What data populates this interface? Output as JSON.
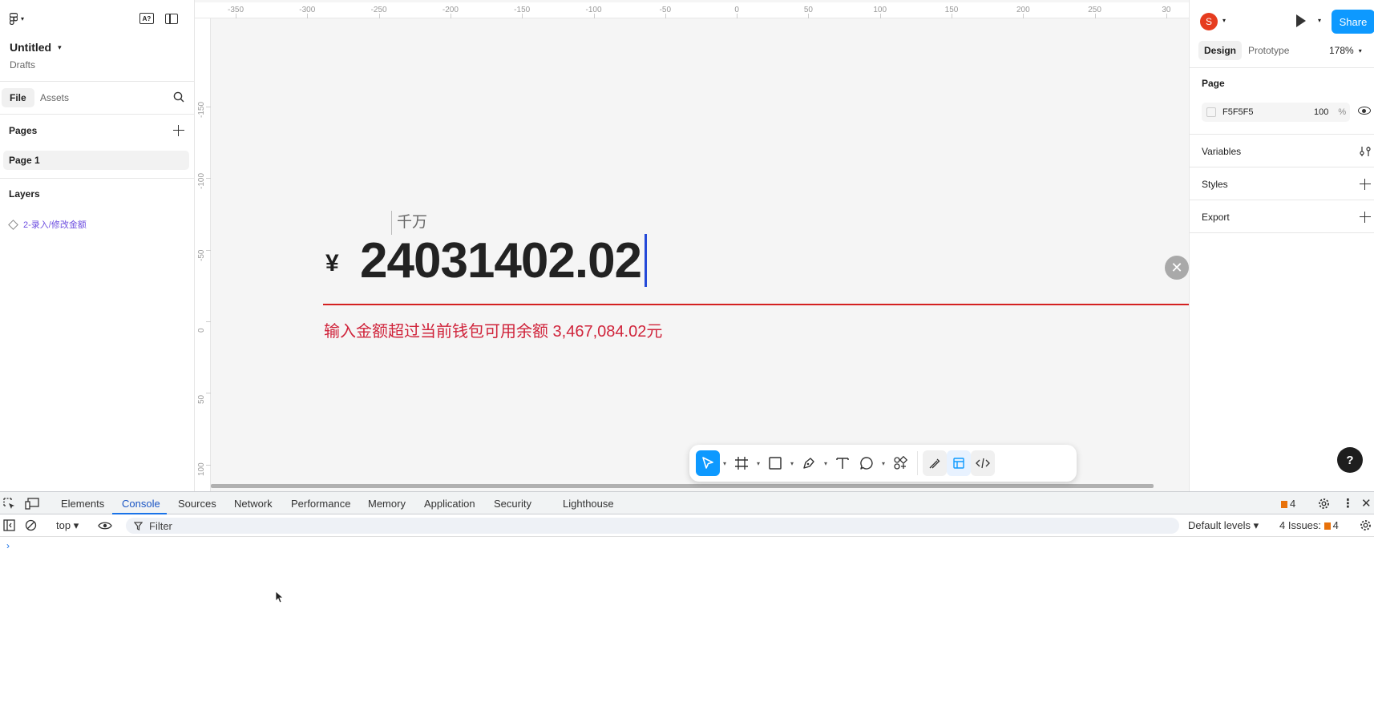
{
  "left_panel": {
    "file_title": "Untitled",
    "file_location": "Drafts",
    "tabs": {
      "file": "File",
      "assets": "Assets"
    },
    "pages_title": "Pages",
    "pages": [
      {
        "label": "Page 1"
      }
    ],
    "layers_title": "Layers",
    "layers": [
      {
        "label": "2-录入/修改金额"
      }
    ]
  },
  "rulers": {
    "top": [
      "-350",
      "-300",
      "-250",
      "-200",
      "-150",
      "-100",
      "-50",
      "0",
      "50",
      "100",
      "150",
      "200",
      "250",
      "30"
    ],
    "left": [
      "-150",
      "-100",
      "-50",
      "0",
      "50",
      "100"
    ]
  },
  "canvas": {
    "unit_hint": "千万",
    "currency": "¥",
    "amount": "24031402.02",
    "error_message": "输入金额超过当前钱包可用余额 3,467,084.02元",
    "clear_icon": "✕"
  },
  "toolbar": {
    "tools": [
      "move-tool",
      "frame-tool",
      "rectangle-tool",
      "pen-tool",
      "text-tool",
      "comment-tool",
      "actions-tool",
      "draw-mode",
      "design-mode",
      "dev-mode"
    ]
  },
  "right_panel": {
    "avatar_initial": "S",
    "share_label": "Share",
    "tabs": {
      "design": "Design",
      "prototype": "Prototype"
    },
    "zoom": "178%",
    "page_section": "Page",
    "page_fill_hex": "F5F5F5",
    "page_fill_opacity": "100",
    "page_fill_unit": "%",
    "variables_label": "Variables",
    "styles_label": "Styles",
    "export_label": "Export",
    "help_label": "?"
  },
  "devtools": {
    "tabs": [
      "Elements",
      "Console",
      "Sources",
      "Network",
      "Performance",
      "Memory",
      "Application",
      "Security",
      "Lighthouse"
    ],
    "active_tab": "Console",
    "issues_badge": "4",
    "context": "top",
    "filter_placeholder": "Filter",
    "levels": "Default levels",
    "issues_label": "4 Issues:",
    "issues_count": "4",
    "prompt": "›"
  },
  "colors": {
    "accent": "#0d99ff",
    "error": "#d0243b",
    "canvas_bg": "#f5f5f5",
    "caret": "#2449d8"
  }
}
